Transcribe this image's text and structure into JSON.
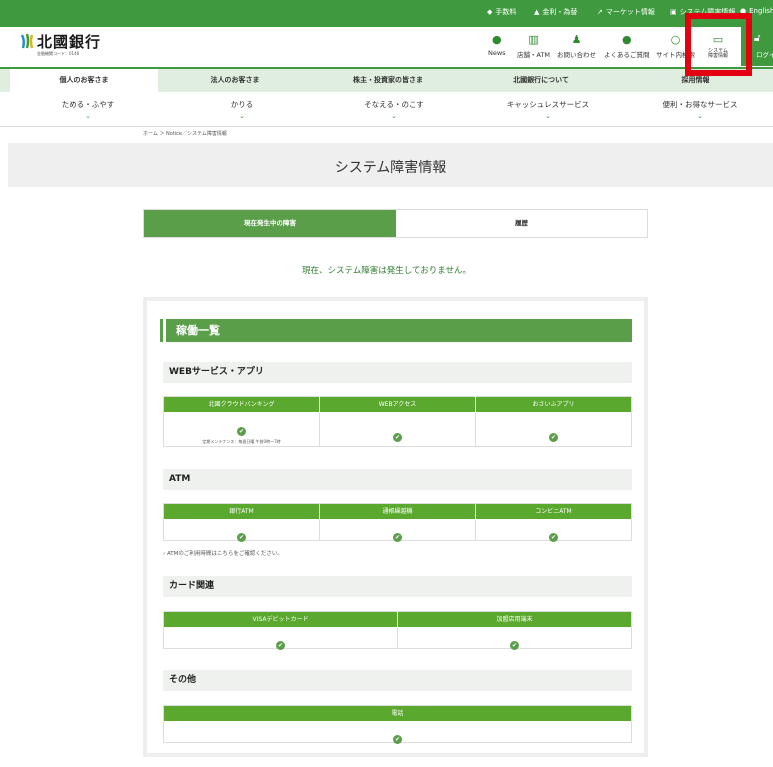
{
  "topbar": {
    "fees": "手数料",
    "rates": "金利・為替",
    "market": "マーケット情報",
    "sysinfo": "システム障害情報",
    "english": "English"
  },
  "logo": {
    "name": "北國銀行",
    "code": "金融機関コード：0146"
  },
  "header_nav": [
    {
      "label": "News",
      "icon": "bulb-icon"
    },
    {
      "label": "店舗・ATM",
      "icon": "building-icon"
    },
    {
      "label": "お問い合わせ",
      "icon": "person-icon"
    },
    {
      "label": "よくあるご質問",
      "icon": "question-icon"
    },
    {
      "label": "サイト内検索",
      "icon": "search-icon"
    },
    {
      "label": "システム 障害情報",
      "icon": "monitor-icon"
    },
    {
      "label": "ログイン",
      "icon": "lock-icon"
    }
  ],
  "main_nav": [
    "個人のお客さま",
    "法人のお客さま",
    "株主・投資家の皆さま",
    "北國銀行について",
    "採用情報"
  ],
  "sub_nav": [
    "ためる・ふやす",
    "かりる",
    "そなえる・のこす",
    "キャッシュレスサービス",
    "便利・お得なサービス"
  ],
  "breadcrumb": "ホーム ＞ Notice／システム障害情報",
  "page_title": "システム障害情報",
  "tabs": {
    "current": "現在発生中の障害",
    "history": "履歴"
  },
  "notice": "現在、システム障害は発生しておりません。",
  "section_title": "稼働一覧",
  "categories": {
    "web": "WEBサービス・アプリ",
    "atm": "ATM",
    "card": "カード関連",
    "other": "その他"
  },
  "web_cols": [
    "北國クラウドバンキング",
    "WEBアクセス",
    "おさいふアプリ"
  ],
  "web_note": "定期メンテナンス：毎週日曜 午前0時〜7時",
  "atm_cols": [
    "銀行ATM",
    "通帳繰越機",
    "コンビニATM"
  ],
  "atm_link": "› ATMのご利用時間はこちらをご確認ください。",
  "card_cols": [
    "VISAデビットカード",
    "加盟店用端末"
  ],
  "other_cols": [
    "電話"
  ],
  "status_mark": "✔"
}
